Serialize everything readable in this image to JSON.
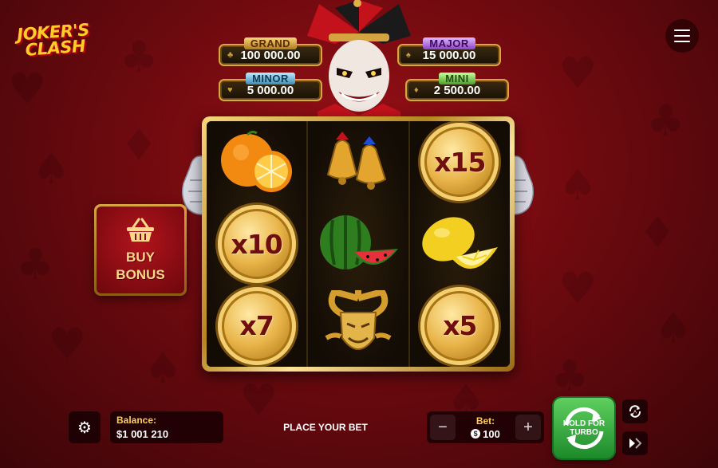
{
  "logo": {
    "line1": "JOKER'S",
    "line2": "CLASH"
  },
  "jackpots": [
    {
      "label": "GRAND",
      "value": "100 000.00"
    },
    {
      "label": "MAJOR",
      "value": "15 000.00"
    },
    {
      "label": "MINOR",
      "value": "5 000.00"
    },
    {
      "label": "MINI",
      "value": "2 500.00"
    }
  ],
  "reels": [
    [
      "orange",
      "x10",
      "x7"
    ],
    [
      "bells",
      "watermelon",
      "jester-mask"
    ],
    [
      "x15",
      "lemon",
      "x5"
    ]
  ],
  "multipliers": {
    "r0c1": "x10",
    "r0c2": "x7",
    "r2c0": "x15",
    "r2c2": "x5"
  },
  "buy_bonus": {
    "line1": "BUY",
    "line2": "BONUS",
    "icon": "basket-icon"
  },
  "bottom": {
    "balance_label": "Balance:",
    "balance_value": "$1 001 210",
    "status": "PLACE YOUR BET",
    "bet_label": "Bet:",
    "bet_value": "100",
    "minus": "−",
    "plus": "+",
    "spin_line1": "HOLD FOR",
    "spin_line2": "TURBO"
  },
  "colors": {
    "background": "#7a0b10",
    "gold": "#d9a640",
    "spin": "#2e9b38"
  }
}
